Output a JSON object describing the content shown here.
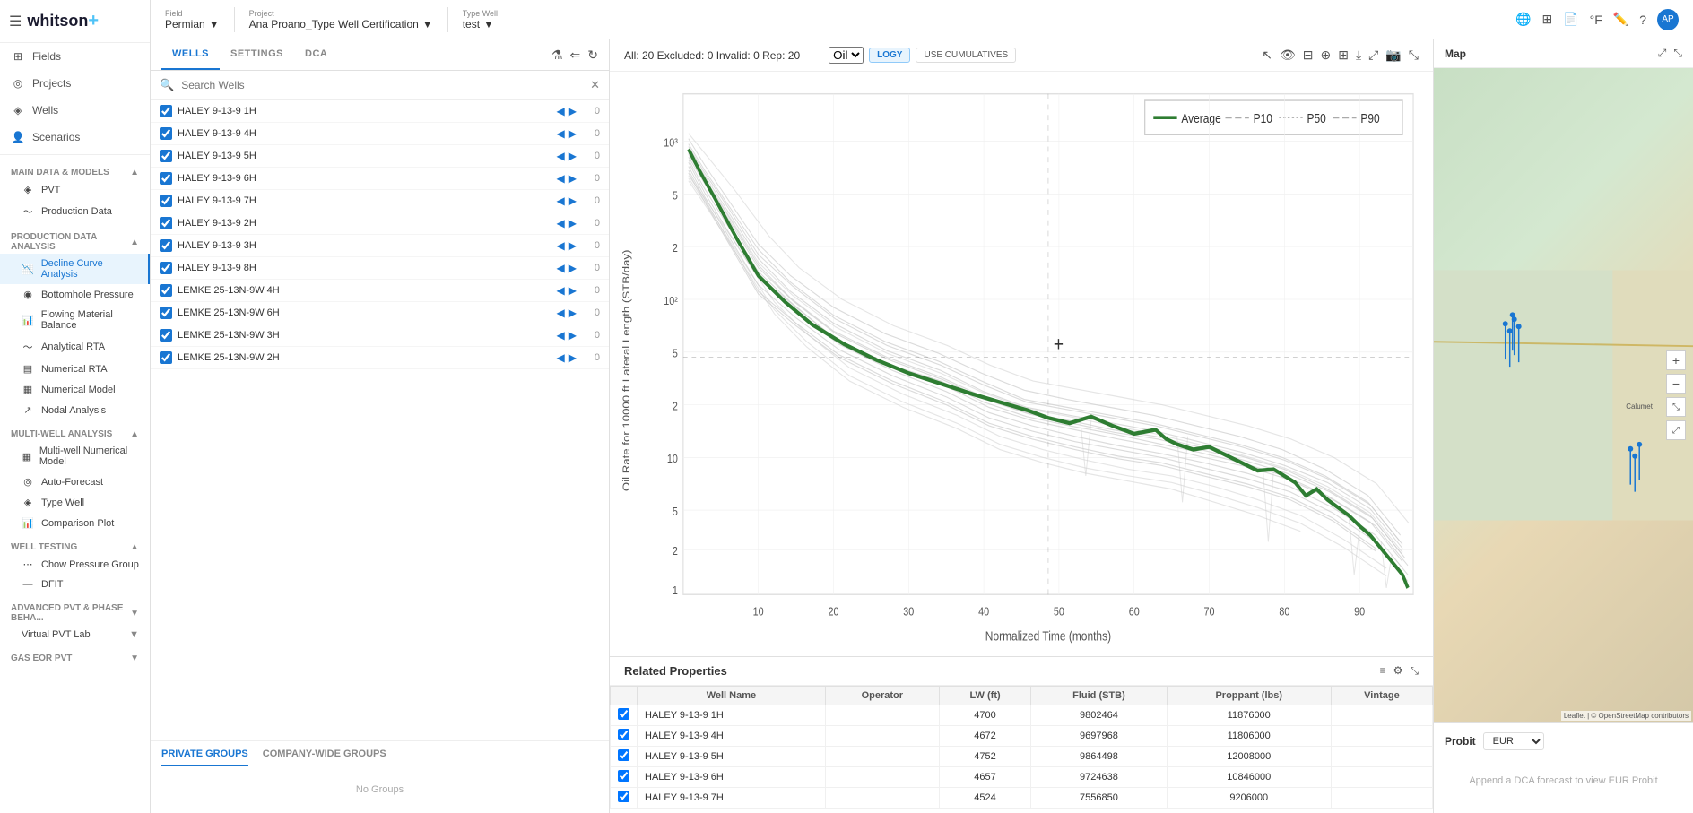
{
  "sidebar": {
    "logo": "whitson",
    "logo_plus": "+",
    "nav_items": [
      {
        "label": "Fields",
        "icon": "⊞"
      },
      {
        "label": "Projects",
        "icon": "◎"
      },
      {
        "label": "Wells",
        "icon": "◈"
      },
      {
        "label": "Scenarios",
        "icon": "👤"
      }
    ],
    "sections": [
      {
        "label": "Main Data & Models",
        "items": [
          {
            "label": "PVT",
            "icon": "◈"
          },
          {
            "label": "Production Data",
            "icon": "〜"
          }
        ]
      },
      {
        "label": "Production Data Analysis",
        "items": [
          {
            "label": "Decline Curve Analysis",
            "icon": "📉",
            "active": true
          },
          {
            "label": "Bottomhole Pressure",
            "icon": "◉"
          },
          {
            "label": "Flowing Material Balance",
            "icon": "📊"
          },
          {
            "label": "Analytical RTA",
            "icon": "〜"
          },
          {
            "label": "Numerical RTA",
            "icon": "▤"
          },
          {
            "label": "Numerical Model",
            "icon": "▦"
          },
          {
            "label": "Nodal Analysis",
            "icon": "↗"
          }
        ]
      },
      {
        "label": "Multi-Well Analysis",
        "items": [
          {
            "label": "Multi-well Numerical Model",
            "icon": "▦"
          },
          {
            "label": "Auto-Forecast",
            "icon": "◎"
          },
          {
            "label": "Type Well",
            "icon": "◈"
          },
          {
            "label": "Comparison Plot",
            "icon": "📊"
          }
        ]
      },
      {
        "label": "Well Testing",
        "items": [
          {
            "label": "Chow Pressure Group",
            "icon": "⋯"
          },
          {
            "label": "DFIT",
            "icon": "—"
          }
        ]
      },
      {
        "label": "Advanced PVT & Phase Beha...",
        "items": [
          {
            "label": "Virtual PVT Lab",
            "icon": ""
          }
        ]
      },
      {
        "label": "Gas EOR PVT",
        "items": []
      }
    ]
  },
  "header": {
    "field_label": "Field",
    "field_value": "Permian",
    "project_label": "Project",
    "project_value": "Ana Proano_Type Well Certification",
    "type_well_label": "Type Well",
    "type_well_value": "test"
  },
  "left_panel": {
    "tabs": [
      "WELLS",
      "SETTINGS",
      "DCA"
    ],
    "active_tab": "WELLS",
    "search_placeholder": "Search Wells",
    "wells": [
      {
        "name": "HALEY 9-13-9 1H",
        "count": "0"
      },
      {
        "name": "HALEY 9-13-9 4H",
        "count": "0"
      },
      {
        "name": "HALEY 9-13-9 5H",
        "count": "0"
      },
      {
        "name": "HALEY 9-13-9 6H",
        "count": "0"
      },
      {
        "name": "HALEY 9-13-9 7H",
        "count": "0"
      },
      {
        "name": "HALEY 9-13-9 2H",
        "count": "0"
      },
      {
        "name": "HALEY 9-13-9 3H",
        "count": "0"
      },
      {
        "name": "HALEY 9-13-9 8H",
        "count": "0"
      },
      {
        "name": "LEMKE 25-13N-9W 4H",
        "count": "0"
      },
      {
        "name": "LEMKE 25-13N-9W 6H",
        "count": "0"
      },
      {
        "name": "LEMKE 25-13N-9W 3H",
        "count": "0"
      },
      {
        "name": "LEMKE 25-13N-9W 2H",
        "count": "0"
      }
    ],
    "groups_tabs": [
      "PRIVATE GROUPS",
      "COMPANY-WIDE GROUPS"
    ],
    "no_groups_text": "No Groups"
  },
  "chart": {
    "stats": "All: 20   Excluded: 0   Invalid: 0   Rep: 20",
    "fluid_selector": "Oil",
    "btn_logy": "LOGY",
    "btn_cumulatives": "USE CUMULATIVES",
    "y_axis_label": "Oil Rate for 10000 ft Lateral Length (STB/day)",
    "x_axis_label": "Normalized Time (months)",
    "legend": {
      "average": "Average",
      "p10": "P10",
      "p50": "P50",
      "p90": "P90"
    },
    "x_ticks": [
      "10",
      "20",
      "30",
      "40",
      "50",
      "60",
      "70",
      "80",
      "90"
    ],
    "y_ticks_top": [
      "10³",
      "5",
      "2",
      "10²",
      "5",
      "2",
      "10",
      "5",
      "2",
      "1"
    ]
  },
  "related_properties": {
    "title": "Related Properties",
    "columns": [
      "",
      "Well Name",
      "Operator",
      "LW (ft)",
      "Fluid (STB)",
      "Proppant (lbs)",
      "Vintage"
    ],
    "rows": [
      {
        "name": "HALEY 9-13-9 1H",
        "operator": "",
        "lw": "4700",
        "fluid": "9802464",
        "proppant": "11876000",
        "vintage": ""
      },
      {
        "name": "HALEY 9-13-9 4H",
        "operator": "",
        "lw": "4672",
        "fluid": "9697968",
        "proppant": "11806000",
        "vintage": ""
      },
      {
        "name": "HALEY 9-13-9 5H",
        "operator": "",
        "lw": "4752",
        "fluid": "9864498",
        "proppant": "12008000",
        "vintage": ""
      },
      {
        "name": "HALEY 9-13-9 6H",
        "operator": "",
        "lw": "4657",
        "fluid": "9724638",
        "proppant": "10846000",
        "vintage": ""
      },
      {
        "name": "HALEY 9-13-9 7H",
        "operator": "",
        "lw": "4524",
        "fluid": "7556850",
        "proppant": "9206000",
        "vintage": ""
      }
    ]
  },
  "map": {
    "title": "Map"
  },
  "probit": {
    "title": "Probit",
    "selector": "EUR",
    "empty_text": "Append a DCA forecast to view EUR Probit"
  }
}
